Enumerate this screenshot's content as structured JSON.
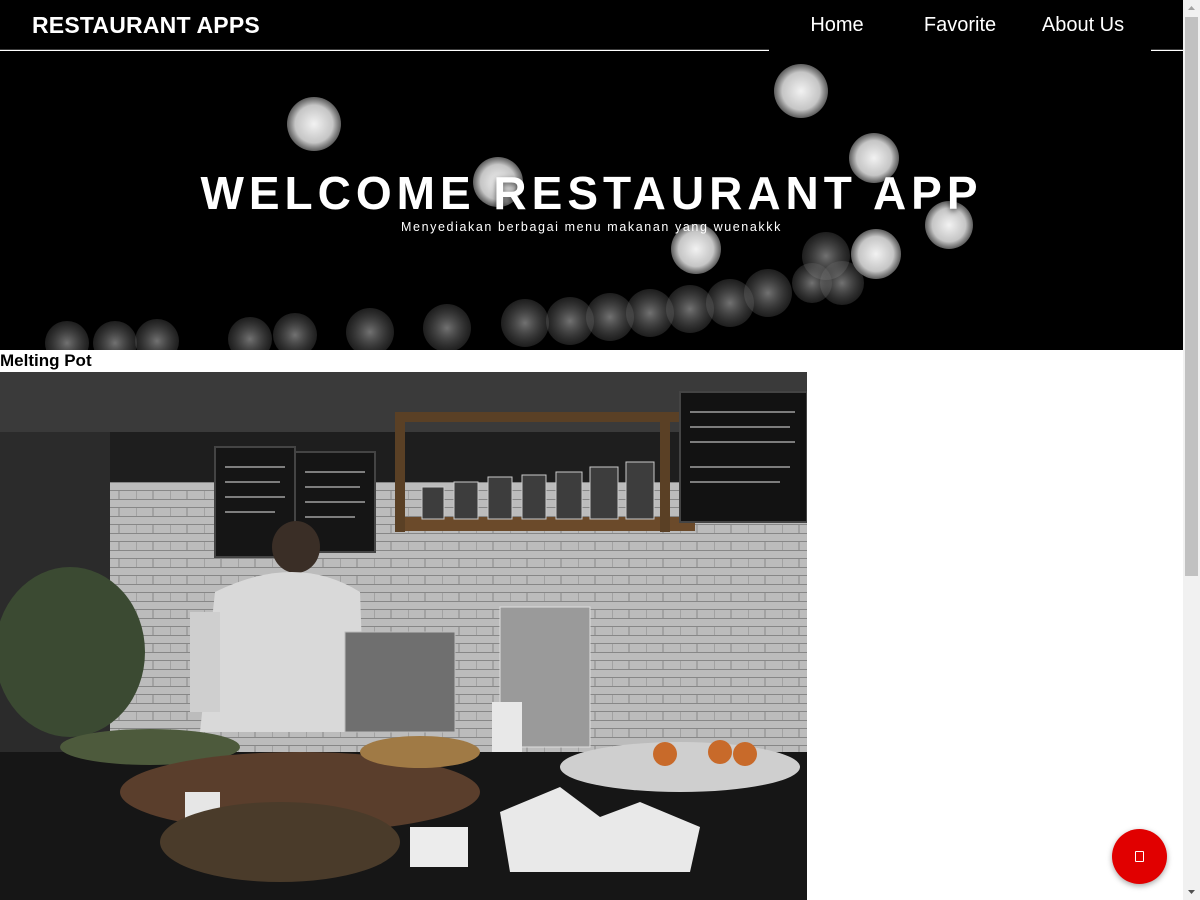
{
  "header": {
    "brand": "RESTAURANT APPS",
    "nav": [
      "Home",
      "Favorite",
      "About Us"
    ]
  },
  "hero": {
    "title": "WELCOME RESTAURANT APP",
    "subtitle": "Menyediakan berbagai menu makanan yang wuenakkk"
  },
  "restaurants": [
    {
      "name": "Melting Pot"
    }
  ],
  "colors": {
    "header_bg": "#000000",
    "hero_bg": "#000000",
    "fab": "#e10000",
    "text": "#000000"
  },
  "icons": {
    "fab": "copy-icon"
  }
}
